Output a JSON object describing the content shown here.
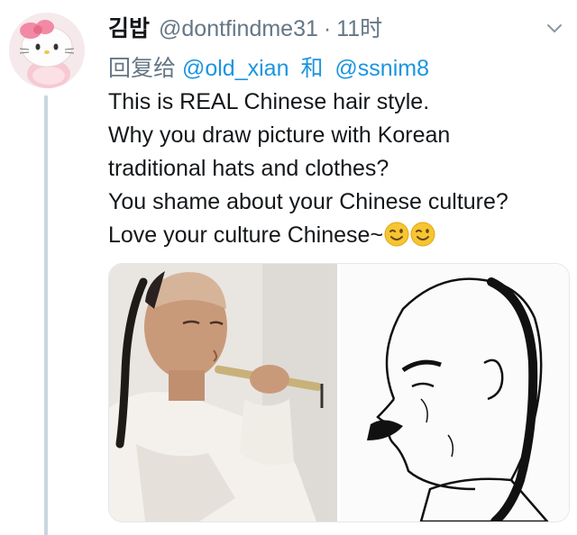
{
  "tweet": {
    "display_name": "김밥",
    "handle": "@dontfindme31",
    "separator": "·",
    "time": "11时",
    "reply_prefix": "回复给",
    "reply_mention_1": "@old_xian",
    "reply_conjunction": "和",
    "reply_mention_2": "@ssnim8",
    "text_lines": [
      "This is REAL Chinese hair style.",
      "Why you draw picture with Korean",
      "traditional hats and clothes?",
      "You shame about your Chinese culture?",
      "Love your culture Chinese~"
    ],
    "emojis": [
      "winking-face-icon",
      "winking-face-icon"
    ]
  },
  "colors": {
    "handle_gray": "#657786",
    "mention_blue": "#1b95e0",
    "thread_line": "#c9d6e0"
  }
}
